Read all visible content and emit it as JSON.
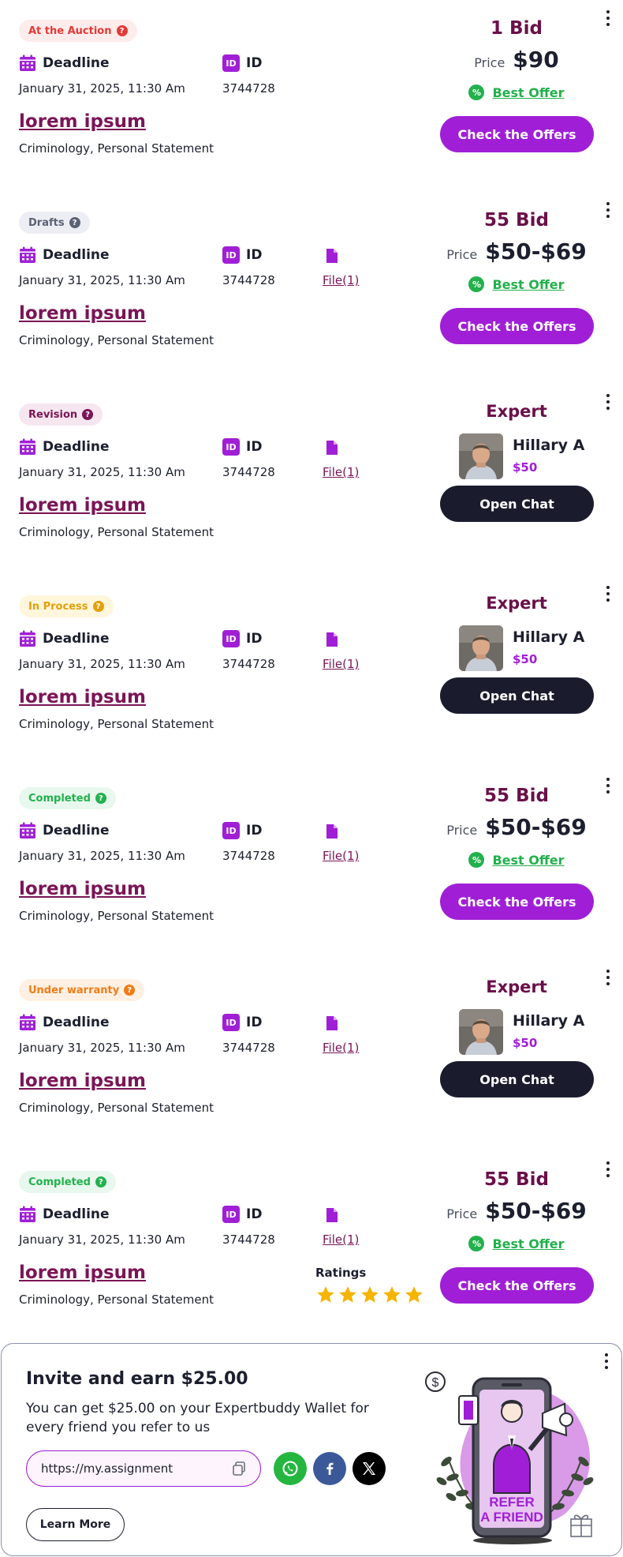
{
  "orders": [
    {
      "status": "At the Auction",
      "status_class": "b-auction",
      "deadline_label": "Deadline",
      "deadline_value": "January 31, 2025, 11:30 Am",
      "id_label": "ID",
      "id_value": "3744728",
      "file_link": "",
      "title": "lorem ipsum",
      "subtitle": "Criminology, Personal Statement",
      "mode": "bid",
      "bids": "1 Bid",
      "price_label": "Price",
      "price_value": "$90",
      "best_offer": "Best Offer",
      "action": "Check the Offers"
    },
    {
      "status": "Drafts",
      "status_class": "b-drafts",
      "deadline_label": "Deadline",
      "deadline_value": "January 31, 2025, 11:30 Am",
      "id_label": "ID",
      "id_value": "3744728",
      "file_link": "File(1)",
      "title": "lorem ipsum",
      "subtitle": "Criminology, Personal Statement",
      "mode": "bid",
      "bids": "55 Bid",
      "price_label": "Price",
      "price_value": "$50-$69",
      "best_offer": "Best Offer",
      "action": "Check the Offers"
    },
    {
      "status": "Revision",
      "status_class": "b-revision",
      "deadline_label": "Deadline",
      "deadline_value": "January 31, 2025, 11:30 Am",
      "id_label": "ID",
      "id_value": "3744728",
      "file_link": "File(1)",
      "title": "lorem ipsum",
      "subtitle": "Criminology, Personal Statement",
      "mode": "expert",
      "expert_label": "Expert",
      "expert_name": "Hillary A",
      "expert_price": "$50",
      "action": "Open Chat"
    },
    {
      "status": "In Process",
      "status_class": "b-process",
      "deadline_label": "Deadline",
      "deadline_value": "January 31, 2025, 11:30 Am",
      "id_label": "ID",
      "id_value": "3744728",
      "file_link": "File(1)",
      "title": "lorem ipsum",
      "subtitle": "Criminology, Personal Statement",
      "mode": "expert",
      "expert_label": "Expert",
      "expert_name": "Hillary A",
      "expert_price": "$50",
      "action": "Open Chat"
    },
    {
      "status": "Completed",
      "status_class": "b-completed",
      "deadline_label": "Deadline",
      "deadline_value": "January 31, 2025, 11:30 Am",
      "id_label": "ID",
      "id_value": "3744728",
      "file_link": "File(1)",
      "title": "lorem ipsum",
      "subtitle": "Criminology, Personal Statement",
      "mode": "bid",
      "bids": "55 Bid",
      "price_label": "Price",
      "price_value": "$50-$69",
      "best_offer": "Best Offer",
      "action": "Check the Offers"
    },
    {
      "status": "Under warranty",
      "status_class": "b-warranty",
      "deadline_label": "Deadline",
      "deadline_value": "January 31, 2025, 11:30 Am",
      "id_label": "ID",
      "id_value": "3744728",
      "file_link": "File(1)",
      "title": "lorem ipsum",
      "subtitle": "Criminology, Personal Statement",
      "mode": "expert",
      "expert_label": "Expert",
      "expert_name": "Hillary A",
      "expert_price": "$50",
      "action": "Open Chat"
    },
    {
      "status": "Completed",
      "status_class": "b-completed",
      "deadline_label": "Deadline",
      "deadline_value": "January 31, 2025, 11:30 Am",
      "id_label": "ID",
      "id_value": "3744728",
      "file_link": "File(1)",
      "title": "lorem ipsum",
      "subtitle": "Criminology, Personal Statement",
      "mode": "bid",
      "bids": "55 Bid",
      "price_label": "Price",
      "price_value": "$50-$69",
      "best_offer": "Best Offer",
      "action": "Check the Offers",
      "ratings_label": "Ratings",
      "rating": 5
    }
  ],
  "invite": {
    "title": "Invite and earn $25.00",
    "text": "You can get $25.00 on your Expertbuddy Wallet for every friend you refer to us",
    "url": "https://my.assignment",
    "learn_more": "Learn More",
    "art_line1": "REFER",
    "art_line2": "A FRIEND",
    "art_dollar": "$"
  },
  "colors": {
    "accent": "#a01fd6",
    "maroon": "#7a1556",
    "success": "#22b14c",
    "dark": "#1a1c2e",
    "whatsapp": "#25b640",
    "facebook": "#3b5998",
    "x": "#000000"
  },
  "icons": [
    "calendar-icon",
    "id-icon",
    "file-icon",
    "question-icon",
    "percent-icon",
    "more-vert-icon",
    "star-icon",
    "copy-icon",
    "whatsapp-icon",
    "facebook-icon",
    "x-icon"
  ]
}
